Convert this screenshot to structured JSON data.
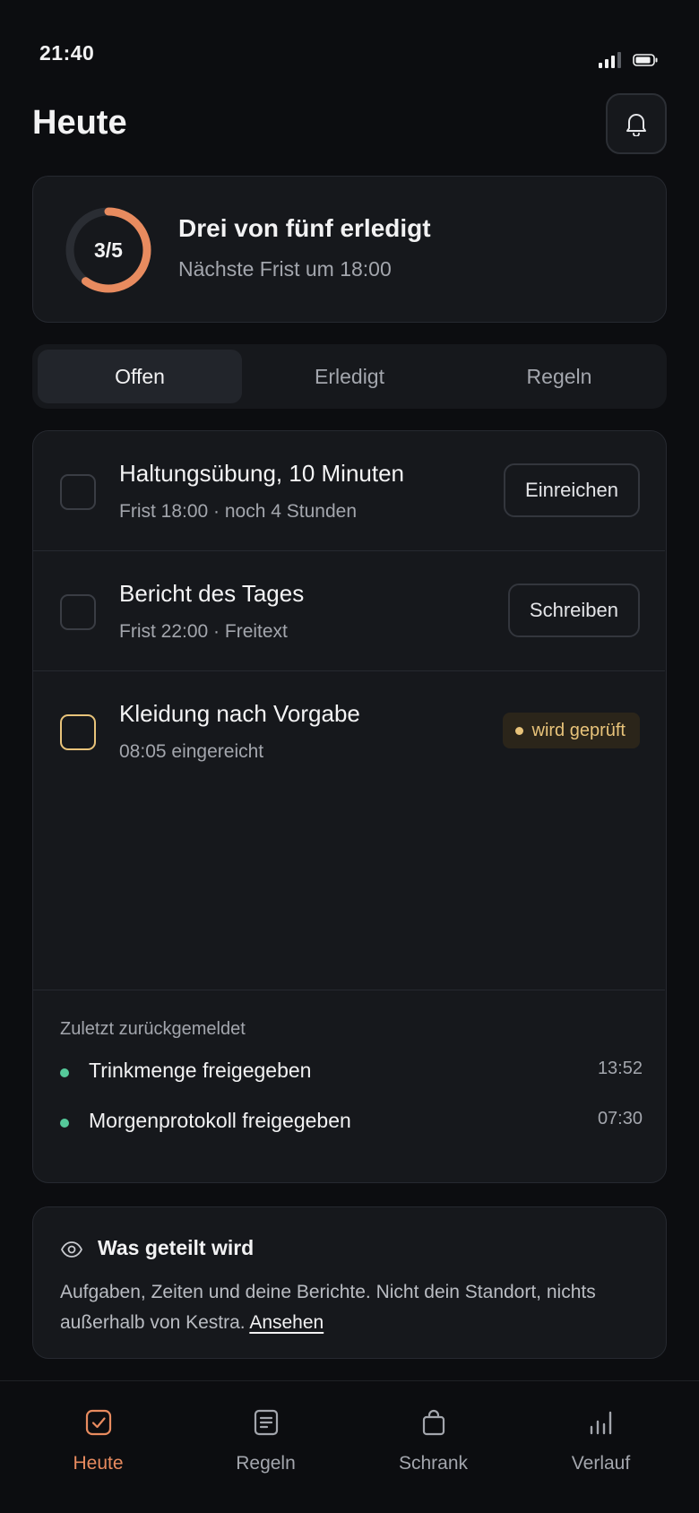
{
  "status_bar": {
    "time": "21:40",
    "signal_icon": "signal-icon",
    "battery_icon": "battery-icon"
  },
  "header": {
    "title": "Heute",
    "bell_icon": "bell-icon"
  },
  "summary": {
    "progress_label": "3/5",
    "progress_fraction": 0.6,
    "title": "Drei von fünf erledigt",
    "subtitle": "Nächste Frist um 18:00",
    "accent_color": "#e88b5f"
  },
  "tabs": [
    {
      "label": "Offen",
      "active": true
    },
    {
      "label": "Erledigt",
      "active": false
    },
    {
      "label": "Regeln",
      "active": false
    }
  ],
  "tasks": [
    {
      "title": "Haltungsübung, 10 Minuten",
      "meta": "Frist 18:00 · noch 4 Stunden",
      "action": "Einreichen"
    },
    {
      "title": "Bericht des Tages",
      "meta": "Frist 22:00 · Freitext",
      "action": "Schreiben"
    },
    {
      "title": "Kleidung nach Vorgabe",
      "meta": "08:05 eingereicht",
      "badge": "wird geprüft",
      "badge_color": "#e8c37a"
    }
  ],
  "recent": {
    "heading": "Zuletzt zurückgemeldet",
    "items": [
      {
        "text": "Trinkmenge freigegeben",
        "time": "13:52"
      },
      {
        "text": "Morgenprotokoll freigegeben",
        "time": "07:30"
      }
    ],
    "dot_color": "#55c99a"
  },
  "sharing": {
    "icon": "eye-icon",
    "title": "Was geteilt wird",
    "body": "Aufgaben, Zeiten und deine Berichte. Nicht dein Standort, nichts außerhalb von Kestra.",
    "link": "Ansehen"
  },
  "bottom_nav": [
    {
      "label": "Heute",
      "icon": "checkbox-icon",
      "active": true
    },
    {
      "label": "Regeln",
      "icon": "document-icon",
      "active": false
    },
    {
      "label": "Schrank",
      "icon": "bag-icon",
      "active": false
    },
    {
      "label": "Verlauf",
      "icon": "bar-chart-icon",
      "active": false
    }
  ]
}
